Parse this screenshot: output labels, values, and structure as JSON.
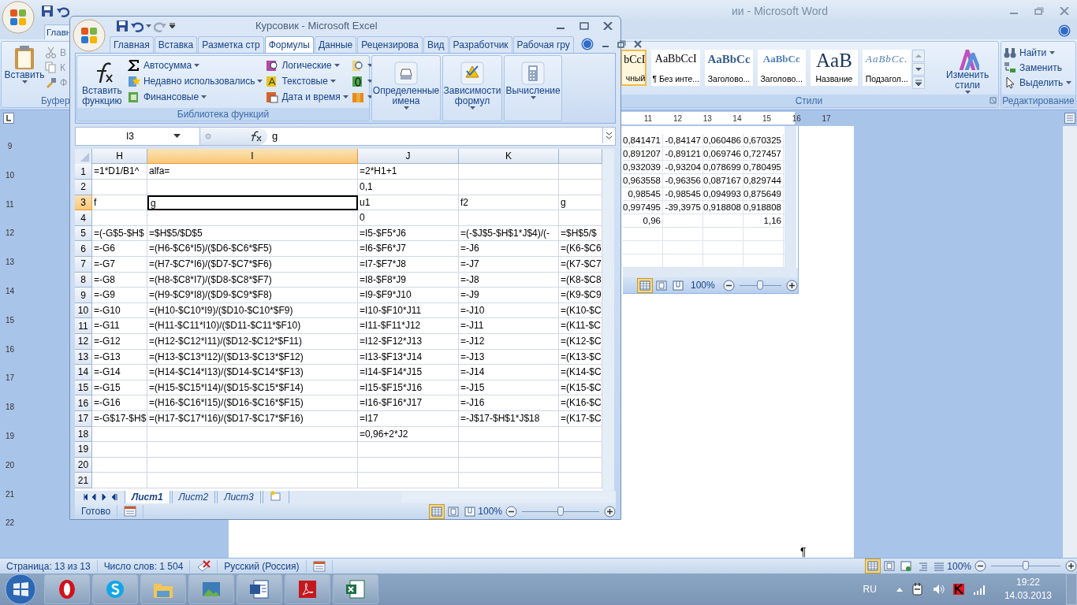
{
  "word": {
    "title": "ии - Microsoft Word",
    "tabs": [
      {
        "label": "Главн",
        "selected": true
      }
    ],
    "clipboard": {
      "paste": "Вставить",
      "small": [
        "В",
        "К",
        "Ф"
      ],
      "group": "Буфер"
    },
    "styles": [
      {
        "kind": "normal",
        "sample": "bCcI",
        "label": "чный",
        "selected": true
      },
      {
        "kind": "normal",
        "sample": "AaBbCcI",
        "label": "¶ Без инте...",
        "selected": false
      },
      {
        "kind": "heading1",
        "sample": "AaBbCc",
        "label": "Заголово...",
        "selected": false
      },
      {
        "kind": "heading2",
        "sample": "AaBbCc",
        "label": "Заголово...",
        "selected": false
      },
      {
        "kind": "title",
        "sample": "AaB",
        "label": "Название",
        "selected": false
      },
      {
        "kind": "subtitle",
        "sample": "AaBbCc.",
        "label": "Подзагол...",
        "selected": false
      }
    ],
    "change_styles": "Изменить стили",
    "styles_group": "Стили",
    "editing": {
      "items": [
        {
          "label": "Найти",
          "dropdown": true
        },
        {
          "label": "Заменить",
          "dropdown": false
        },
        {
          "label": "Выделить",
          "dropdown": true
        }
      ],
      "group": "Редактирование"
    },
    "ruler_h": [
      "11",
      "12",
      "13",
      "14",
      "15",
      "16",
      "17"
    ],
    "ruler_v": [
      "9",
      "10",
      "11",
      "12",
      "13",
      "14",
      "15",
      "16",
      "17",
      "18",
      "19",
      "20",
      "21",
      "22"
    ],
    "object": {
      "rows": [
        [
          "0,841471",
          "-0,84147",
          "0,060486",
          "0,670325"
        ],
        [
          "0,891207",
          "-0,89121",
          "0,069746",
          "0,727457"
        ],
        [
          "0,932039",
          "-0,93204",
          "0,078699",
          "0,780495"
        ],
        [
          "0,963558",
          "-0,96356",
          "0,087167",
          "0,829744"
        ],
        [
          "0,98545",
          "-0,98545",
          "0,094993",
          "0,875649"
        ],
        [
          "0,997495",
          "-39,3975",
          "0,918808",
          "0,918808"
        ],
        [
          "0,96",
          null,
          null,
          "1,16"
        ],
        [
          null,
          null,
          null,
          null
        ],
        [
          null,
          null,
          null,
          null
        ],
        [
          null,
          null,
          null,
          null
        ]
      ],
      "views": [
        {
          "selected": true
        },
        {
          "selected": false
        },
        {
          "selected": false
        }
      ],
      "zoom": {
        "label": "100%",
        "level": 0.5
      },
      "paragraph_mark": "¶"
    },
    "status": {
      "page": "Страница: 13 из 13",
      "words": "Число слов: 1 504",
      "language": "Русский (Россия)",
      "views": [
        {
          "selected": true
        },
        {
          "selected": false
        },
        {
          "selected": false
        },
        {
          "selected": false
        },
        {
          "selected": false
        }
      ],
      "zoom": {
        "label": "100%",
        "level": 0.5
      }
    }
  },
  "excel": {
    "title": "Курсовик - Microsoft Excel",
    "tabs": [
      {
        "label": "Главная",
        "selected": false
      },
      {
        "label": "Вставка",
        "selected": false
      },
      {
        "label": "Разметка стр",
        "selected": false
      },
      {
        "label": "Формулы",
        "selected": true
      },
      {
        "label": "Данные",
        "selected": false
      },
      {
        "label": "Рецензирова",
        "selected": false
      },
      {
        "label": "Вид",
        "selected": false
      },
      {
        "label": "Разработчик",
        "selected": false
      },
      {
        "label": "Рабочая гру",
        "selected": false
      }
    ],
    "insert_function": "Вставить функцию",
    "functions": [
      {
        "label": "Автосумма"
      },
      {
        "label": "Недавно использовались"
      },
      {
        "label": "Финансовые"
      },
      {
        "label": "Логические"
      },
      {
        "label": "Текстовые"
      },
      {
        "label": "Дата и время"
      }
    ],
    "library_group": "Библиотека функций",
    "big_buttons": [
      {
        "label": "Определенные имена"
      },
      {
        "label": "Зависимости формул"
      },
      {
        "label": "Вычисление"
      }
    ],
    "name_box": "I3",
    "formula": "g",
    "columns": [
      {
        "label": "H",
        "selected": false
      },
      {
        "label": "I",
        "selected": true
      },
      {
        "label": "J",
        "selected": false
      },
      {
        "label": "K",
        "selected": false
      },
      {
        "selected": false
      }
    ],
    "rows": [
      {
        "label": "1",
        "selected": false,
        "cells": [
          "=1*D1/B1^",
          "alfa=",
          "=2*H1+1",
          null,
          null
        ]
      },
      {
        "label": "2",
        "selected": false,
        "cells": [
          null,
          null,
          "0,1",
          null,
          null
        ]
      },
      {
        "label": "3",
        "selected": true,
        "cells": [
          "f",
          "g",
          "u1",
          "f2",
          "g"
        ]
      },
      {
        "label": "4",
        "selected": false,
        "cells": [
          null,
          null,
          "0",
          null,
          null
        ]
      },
      {
        "label": "5",
        "selected": false,
        "cells": [
          "=(-G$5-$H$",
          "=$H$5/$D$5",
          "=I5-$F5*J6",
          "=(-$J$5-$H$1*J$4)/(-",
          "=$H$5/$"
        ]
      },
      {
        "label": "6",
        "selected": false,
        "cells": [
          "=-G6",
          "=(H6-$C6*I5)/($D6-$C6*$F5)",
          "=I6-$F6*J7",
          "=-J6",
          "=(K6-$C6"
        ]
      },
      {
        "label": "7",
        "selected": false,
        "cells": [
          "=-G7",
          "=(H7-$C7*I6)/($D7-$C7*$F6)",
          "=I7-$F7*J8",
          "=-J7",
          "=(K7-$C7"
        ]
      },
      {
        "label": "8",
        "selected": false,
        "cells": [
          "=-G8",
          "=(H8-$C8*I7)/($D8-$C8*$F7)",
          "=I8-$F8*J9",
          "=-J8",
          "=(K8-$C8"
        ]
      },
      {
        "label": "9",
        "selected": false,
        "cells": [
          "=-G9",
          "=(H9-$C9*I8)/($D9-$C9*$F8)",
          "=I9-$F9*J10",
          "=-J9",
          "=(K9-$C9"
        ]
      },
      {
        "label": "10",
        "selected": false,
        "cells": [
          "=-G10",
          "=(H10-$C10*I9)/($D10-$C10*$F9)",
          "=I10-$F10*J11",
          "=-J10",
          "=(K10-$C"
        ]
      },
      {
        "label": "11",
        "selected": false,
        "cells": [
          "=-G11",
          "=(H11-$C11*I10)/($D11-$C11*$F10)",
          "=I11-$F11*J12",
          "=-J11",
          "=(K11-$C"
        ]
      },
      {
        "label": "12",
        "selected": false,
        "cells": [
          "=-G12",
          "=(H12-$C12*I11)/($D12-$C12*$F11)",
          "=I12-$F12*J13",
          "=-J12",
          "=(K12-$C"
        ]
      },
      {
        "label": "13",
        "selected": false,
        "cells": [
          "=-G13",
          "=(H13-$C13*I12)/($D13-$C13*$F12)",
          "=I13-$F13*J14",
          "=-J13",
          "=(K13-$C"
        ]
      },
      {
        "label": "14",
        "selected": false,
        "cells": [
          "=-G14",
          "=(H14-$C14*I13)/($D14-$C14*$F13)",
          "=I14-$F14*J15",
          "=-J14",
          "=(K14-$C"
        ]
      },
      {
        "label": "15",
        "selected": false,
        "cells": [
          "=-G15",
          "=(H15-$C15*I14)/($D15-$C15*$F14)",
          "=I15-$F15*J16",
          "=-J15",
          "=(K15-$C"
        ]
      },
      {
        "label": "16",
        "selected": false,
        "cells": [
          "=-G16",
          "=(H16-$C16*I15)/($D16-$C16*$F15)",
          "=I16-$F16*J17",
          "=-J16",
          "=(K16-$C"
        ]
      },
      {
        "label": "17",
        "selected": false,
        "cells": [
          "=-G$17-$H$",
          "=(H17-$C17*I16)/($D17-$C17*$F16)",
          "=I17",
          "=-J$17-$H$1*J$18",
          "=(K17-$C"
        ]
      },
      {
        "label": "18",
        "selected": false,
        "cells": [
          null,
          null,
          "=0,96+2*J2",
          null,
          null
        ]
      },
      {
        "label": "19",
        "selected": false,
        "cells": [
          null,
          null,
          null,
          null,
          null
        ]
      },
      {
        "label": "20",
        "selected": false,
        "cells": [
          null,
          null,
          null,
          null,
          null
        ]
      },
      {
        "label": "21",
        "selected": false,
        "cells": [
          null,
          null,
          null,
          null,
          null
        ]
      }
    ],
    "sheets": [
      {
        "label": "Лист1",
        "selected": true
      },
      {
        "label": "Лист2",
        "selected": false
      },
      {
        "label": "Лист3",
        "selected": false
      }
    ],
    "status": "Готово",
    "views": [
      {
        "selected": true
      },
      {
        "selected": false
      },
      {
        "selected": false
      }
    ],
    "zoom": {
      "label": "100%",
      "level": 0.5
    }
  },
  "tray": {
    "language": "RU",
    "time": "19:22",
    "date": "14.03.2013"
  }
}
